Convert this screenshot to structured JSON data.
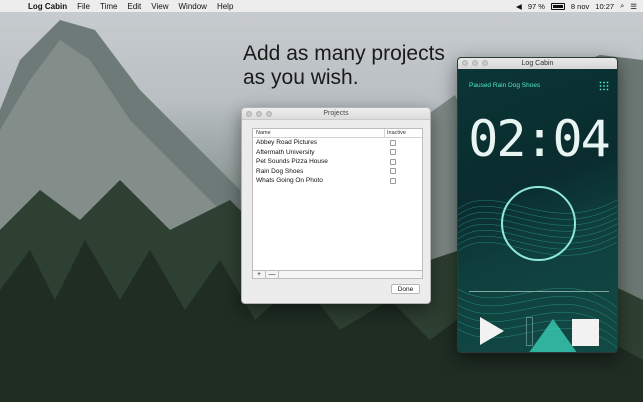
{
  "menubar": {
    "app_name": "Log Cabin",
    "menus": [
      "File",
      "Time",
      "Edit",
      "View",
      "Window",
      "Help"
    ],
    "battery": "97 %",
    "date": "8 nov",
    "time": "10:27"
  },
  "headline": {
    "line1": "Add as many projects",
    "line2": "as you wish."
  },
  "projects_window": {
    "title": "Projects",
    "col_name": "Name",
    "col_inactive": "Inactive",
    "rows": [
      {
        "name": "Abbey Road Pictures",
        "inactive": false
      },
      {
        "name": "Aftermath University",
        "inactive": false
      },
      {
        "name": "Pet Sounds Pizza House",
        "inactive": false
      },
      {
        "name": "Rain Dog Shoes",
        "inactive": false
      },
      {
        "name": "Whats Going On Photo",
        "inactive": false
      }
    ],
    "add_label": "+",
    "remove_label": "—",
    "done_label": "Done"
  },
  "log_cabin_window": {
    "title": "Log Cabin",
    "status": "Paused Rain Dog Shoes",
    "timer": "02:04",
    "accent": "#4fe8c6"
  }
}
